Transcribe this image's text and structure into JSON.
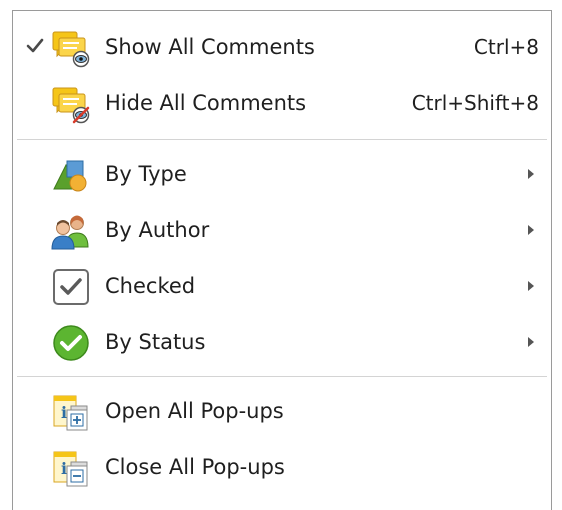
{
  "menu": {
    "items": [
      {
        "label": "Show All Comments",
        "shortcut": "Ctrl+8",
        "checked": true,
        "icon": "comments-show-icon"
      },
      {
        "label": "Hide All Comments",
        "shortcut": "Ctrl+Shift+8",
        "checked": false,
        "icon": "comments-hide-icon"
      },
      {
        "label": "By Type",
        "submenu": true,
        "icon": "shapes-icon"
      },
      {
        "label": "By Author",
        "submenu": true,
        "icon": "users-icon"
      },
      {
        "label": "Checked",
        "submenu": true,
        "icon": "checkbox-icon"
      },
      {
        "label": "By Status",
        "submenu": true,
        "icon": "status-check-icon"
      },
      {
        "label": "Open All Pop-ups",
        "icon": "popup-open-icon"
      },
      {
        "label": "Close All Pop-ups",
        "icon": "popup-close-icon"
      }
    ]
  },
  "colors": {
    "note_yellow": "#f5c518",
    "status_green": "#5cb531",
    "separator": "#d4d4d4",
    "border": "#9a9a9a"
  }
}
